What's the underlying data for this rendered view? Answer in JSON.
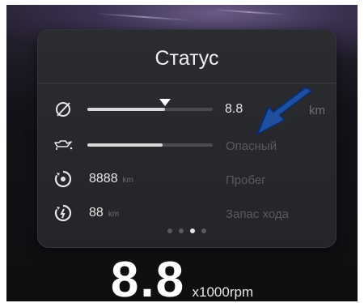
{
  "status_panel": {
    "title": "Статус",
    "rows": [
      {
        "icon": "fuel-consumption-icon",
        "value": "8.8",
        "unit_partial": "km",
        "progress": 0.62,
        "pointer": 0.62
      },
      {
        "icon": "oil-lamp-icon",
        "label": "Опасный",
        "progress": 0.6
      },
      {
        "icon": "odometer-icon",
        "value": "8888",
        "unit": "km",
        "label": "Пробег"
      },
      {
        "icon": "range-icon",
        "value": "88",
        "unit": "km",
        "label": "Запас хода"
      }
    ],
    "pagination": {
      "count": 4,
      "active_index": 2
    }
  },
  "rpm": {
    "value": "8.8",
    "unit": "x1000rpm"
  },
  "colors": {
    "annotation_arrow": "#1e4fa0",
    "panel": "#2a2b2f",
    "text": "#f0f0f0"
  }
}
